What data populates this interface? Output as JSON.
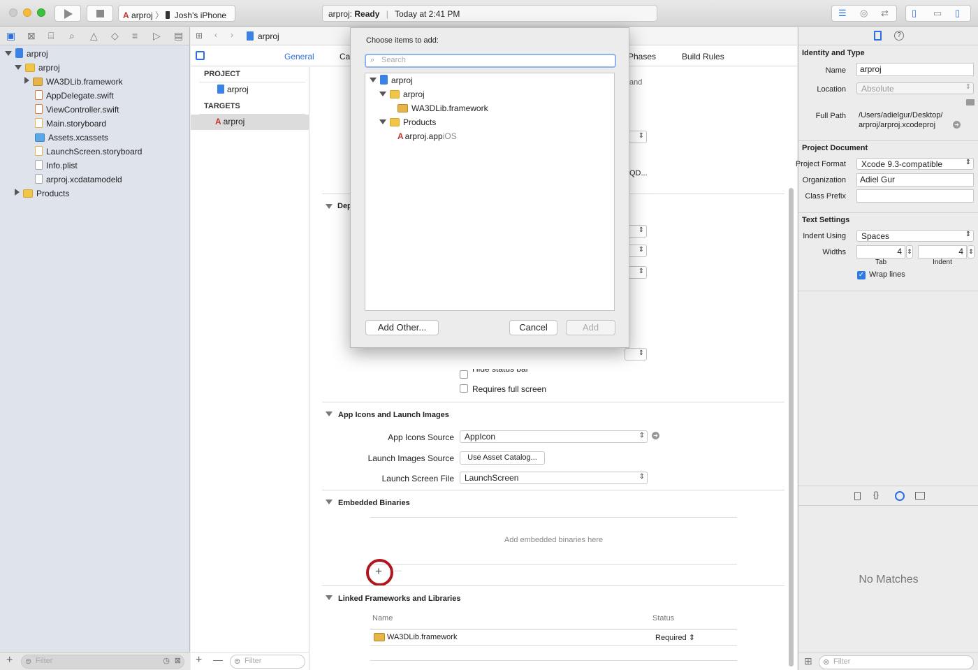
{
  "toolbar": {
    "scheme_name": "arproj",
    "device_name": "Josh's iPhone",
    "activity_project": "arproj:",
    "activity_status": "Ready",
    "activity_time": "Today at 2:41 PM"
  },
  "navigator": {
    "items": [
      {
        "label": "arproj"
      },
      {
        "label": "arproj"
      },
      {
        "label": "WA3DLib.framework"
      },
      {
        "label": "AppDelegate.swift"
      },
      {
        "label": "ViewController.swift"
      },
      {
        "label": "Main.storyboard"
      },
      {
        "label": "Assets.xcassets"
      },
      {
        "label": "LaunchScreen.storyboard"
      },
      {
        "label": "Info.plist"
      },
      {
        "label": "arproj.xcdatamodeld"
      },
      {
        "label": "Products"
      }
    ],
    "filter_placeholder": "Filter"
  },
  "editor": {
    "breadcrumb": "arproj",
    "tabs": [
      "General",
      "Ca",
      "Phases",
      "Build Rules"
    ],
    "project_header": "PROJECT",
    "project_item": "arproj",
    "targets_header": "TARGETS",
    "target_item": "arproj",
    "targets_filter_placeholder": "Filter",
    "partial_texts": {
      "and": "and",
      "qd": "QD...",
      "dep": "Dep",
      "hide_status": "Hide status bar"
    },
    "requires_full_screen": "Requires full screen",
    "app_icons": {
      "header": "App Icons and Launch Images",
      "icons_source_label": "App Icons Source",
      "icons_source_value": "AppIcon",
      "launch_images_label": "Launch Images Source",
      "launch_images_button": "Use Asset Catalog...",
      "launch_screen_label": "Launch Screen File",
      "launch_screen_value": "LaunchScreen"
    },
    "embedded": {
      "header": "Embedded Binaries",
      "empty_text": "Add embedded binaries here",
      "add": "+",
      "remove": "—"
    },
    "linked": {
      "header": "Linked Frameworks and Libraries",
      "col_name": "Name",
      "col_status": "Status",
      "rows": [
        {
          "name": "WA3DLib.framework",
          "status": "Required"
        }
      ],
      "add": "+",
      "remove": "—"
    }
  },
  "modal": {
    "title": "Choose items to add:",
    "search_placeholder": "Search",
    "tree": [
      {
        "label": "arproj"
      },
      {
        "label": "arproj"
      },
      {
        "label": "WA3DLib.framework"
      },
      {
        "label": "Products"
      },
      {
        "label": "arproj.app",
        "suffix": "iOS"
      }
    ],
    "add_other": "Add Other...",
    "cancel": "Cancel",
    "add": "Add"
  },
  "inspector": {
    "identity_header": "Identity and Type",
    "name_label": "Name",
    "name_value": "arproj",
    "location_label": "Location",
    "location_value": "Absolute",
    "full_path_label": "Full Path",
    "full_path_line1": "/Users/adielgur/Desktop/",
    "full_path_line2": "arproj/arproj.xcodeproj",
    "project_doc_header": "Project Document",
    "format_label": "Project Format",
    "format_value": "Xcode 9.3-compatible",
    "org_label": "Organization",
    "org_value": "Adiel Gur",
    "class_prefix_label": "Class Prefix",
    "class_prefix_value": "",
    "text_settings_header": "Text Settings",
    "indent_using_label": "Indent Using",
    "indent_using_value": "Spaces",
    "widths_label": "Widths",
    "tab_value": "4",
    "indent_value": "4",
    "tab_label": "Tab",
    "indent_label": "Indent",
    "wrap_lines": "Wrap lines",
    "no_matches": "No Matches",
    "filter_placeholder": "Filter"
  }
}
